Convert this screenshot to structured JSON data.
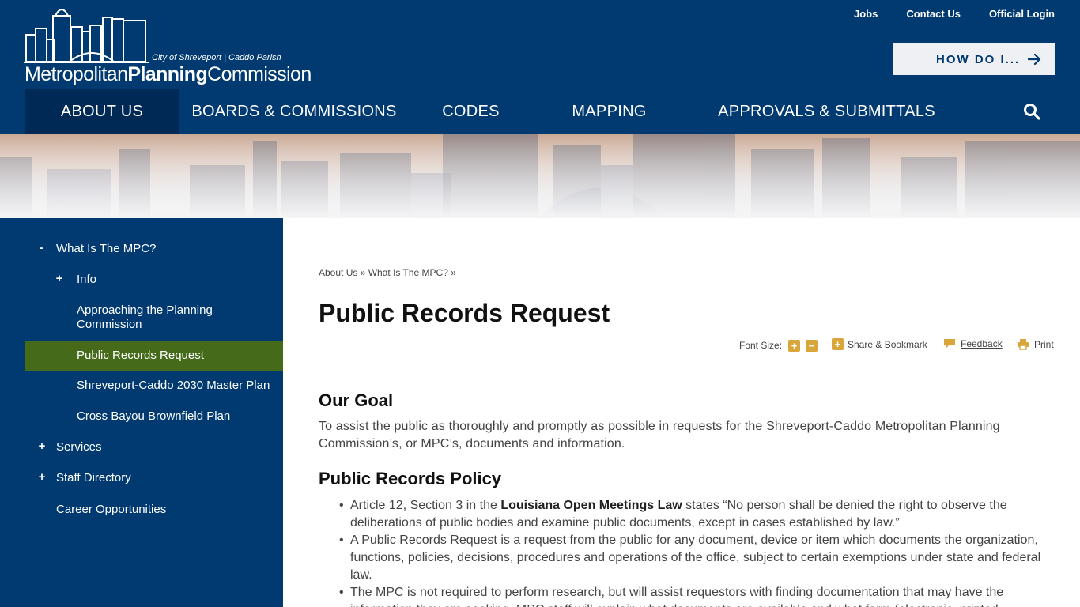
{
  "logo": {
    "city_line": "City of Shreveport | Caddo Parish",
    "name_part1": "Metropolitan",
    "name_part2": "Planning",
    "name_part3": "Commission"
  },
  "utility_nav": [
    {
      "label": "Jobs"
    },
    {
      "label": "Contact Us"
    },
    {
      "label": "Official Login"
    }
  ],
  "how_do_i": {
    "label": "HOW DO I..."
  },
  "main_nav": [
    {
      "label": "ABOUT US",
      "active": true
    },
    {
      "label": "BOARDS & COMMISSIONS",
      "active": false
    },
    {
      "label": "CODES",
      "active": false
    },
    {
      "label": "MAPPING",
      "active": false
    },
    {
      "label": "APPROVALS & SUBMITTALS",
      "active": false
    }
  ],
  "sidebar": {
    "items": [
      {
        "toggle": "-",
        "label": "What Is The MPC?"
      },
      {
        "toggle": "+",
        "label": "Info"
      },
      {
        "toggle": "",
        "label": "Approaching the Planning Commission"
      },
      {
        "toggle": "",
        "label": "Public Records Request",
        "active": true
      },
      {
        "toggle": "",
        "label": "Shreveport-Caddo 2030 Master Plan"
      },
      {
        "toggle": "",
        "label": "Cross Bayou Brownfield Plan"
      },
      {
        "toggle": "+",
        "label": "Services"
      },
      {
        "toggle": "+",
        "label": "Staff Directory"
      },
      {
        "toggle": "",
        "label": "Career Opportunities"
      }
    ]
  },
  "breadcrumb": {
    "items": [
      {
        "label": "About Us"
      },
      {
        "label": "What Is The MPC?"
      }
    ],
    "separator": "»"
  },
  "page": {
    "title": "Public Records Request"
  },
  "tools": {
    "font_size_label": "Font Size:",
    "share_label": "Share & Bookmark",
    "feedback_label": "Feedback",
    "print_label": "Print"
  },
  "sections": {
    "goal_heading": "Our Goal",
    "goal_text": "To assist the public as thoroughly and promptly as possible in requests for the Shreveport-Caddo Metropolitan Planning Commission’s,  or MPC’s,  documents and information.",
    "policy_heading": "Public Records Policy",
    "policy_items": [
      {
        "pre": "Article 12, Section 3 in the ",
        "bold": "Louisiana Open Meetings Law",
        "post": " states “No person shall be denied the right to observe the deliberations of public bodies and examine public documents, except in cases established by law.”"
      },
      {
        "pre": "A Public Records Request is a request from the public for any document, device or item which documents the organization, functions, policies, decisions, procedures and operations of the office, subject to certain exemptions under state and federal law.",
        "bold": "",
        "post": ""
      },
      {
        "pre": "The MPC is not required to perform research, but will assist requestors with finding documentation that may have the information they are seeking. MPC staff will explain what documents are available and what form (electronic, printed",
        "bold": "",
        "post": ""
      }
    ]
  },
  "colors": {
    "header_bg": "#003a70",
    "nav_active_bg": "#002a55",
    "sidebar_active_bg": "#456b1a",
    "tool_icon": "#d9a63b"
  },
  "icons": {
    "search": "search-icon",
    "arrow": "arrow-right-icon",
    "share": "share-plus-icon",
    "feedback": "speech-bubble-icon",
    "print": "printer-icon"
  }
}
